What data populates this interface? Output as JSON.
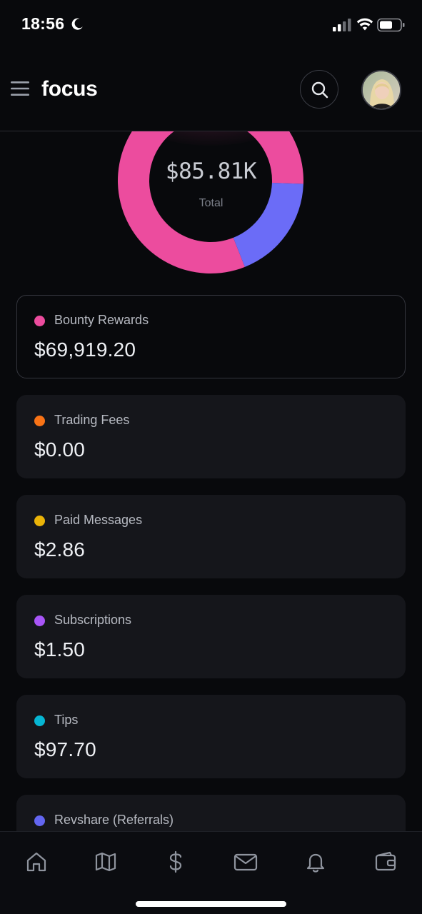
{
  "status_bar": {
    "time": "18:56",
    "moon_icon": "moon-icon",
    "signal_icon": "cellular-signal-icon",
    "wifi_icon": "wifi-icon",
    "battery_icon": "battery-icon"
  },
  "header": {
    "brand": "focus",
    "menu_icon": "hamburger-menu-icon",
    "search_icon": "search-icon",
    "avatar": "user-avatar"
  },
  "donut": {
    "total": "$85.81K",
    "total_label": "Total"
  },
  "chart_data": {
    "type": "pie",
    "style": "donut",
    "center_value": "$85.81K",
    "center_label": "Total",
    "categories": [
      "Bounty Rewards",
      "Revshare (Referrals)"
    ],
    "values": [
      69919.2,
      15800
    ],
    "colors": [
      "#ec4c9e",
      "#6b6cf7"
    ]
  },
  "categories": [
    {
      "label": "Bounty Rewards",
      "amount": "$69,919.20",
      "color": "#ec4c9e",
      "selected": true
    },
    {
      "label": "Trading Fees",
      "amount": "$0.00",
      "color": "#f97316",
      "selected": false
    },
    {
      "label": "Paid Messages",
      "amount": "$2.86",
      "color": "#eab308",
      "selected": false
    },
    {
      "label": "Subscriptions",
      "amount": "$1.50",
      "color": "#a855f7",
      "selected": false
    },
    {
      "label": "Tips",
      "amount": "$97.70",
      "color": "#06b6d4",
      "selected": false
    },
    {
      "label": "Revshare (Referrals)",
      "amount": "",
      "color": "#6366f1",
      "selected": false
    }
  ],
  "bottom_nav": {
    "items": [
      {
        "icon": "home-icon"
      },
      {
        "icon": "map-icon"
      },
      {
        "icon": "dollar-icon"
      },
      {
        "icon": "mail-icon"
      },
      {
        "icon": "bell-icon"
      },
      {
        "icon": "wallet-icon"
      }
    ]
  },
  "colors": {
    "background": "#08090c",
    "card": "#15161b",
    "pink": "#ec4c9e",
    "indigo": "#6b6cf7"
  }
}
